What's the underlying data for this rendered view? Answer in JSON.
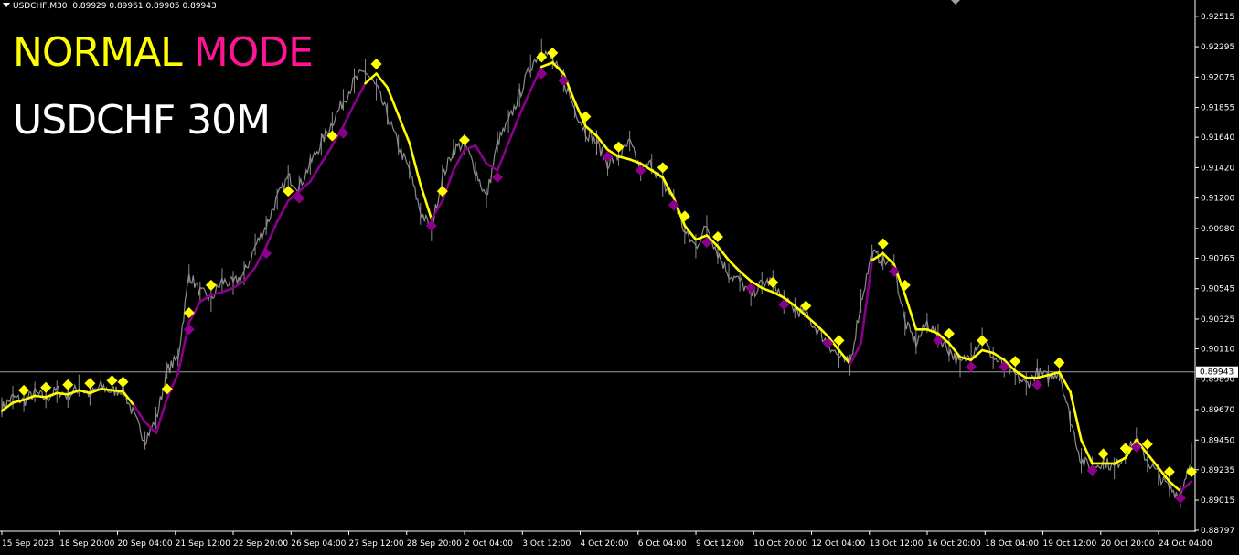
{
  "header": {
    "symbol": "USDCHF,M30",
    "ohlc": "0.89929 0.89961 0.89905 0.89943"
  },
  "overlay": {
    "mode_word1": "NORMAL",
    "mode_word2": "MODE",
    "pair_timeframe": "USDCHF 30M"
  },
  "colors": {
    "background": "#000000",
    "price": "#8c8c8c",
    "trend_up_line": "#ffff00",
    "trend_down_line": "#8b008b",
    "signal_up": "#ffff00",
    "signal_down": "#8b008b",
    "axis": "#ffffff",
    "current_price_line": "#a0a0a0"
  },
  "chart_data": {
    "type": "line",
    "title": "",
    "current_price": "0.89943",
    "ylim": [
      0.88797,
      0.9258
    ],
    "y_ticks": [
      "0.92515",
      "0.92295",
      "0.92075",
      "0.91855",
      "0.91640",
      "0.91420",
      "0.91200",
      "0.90980",
      "0.90765",
      "0.90545",
      "0.90325",
      "0.90110",
      "0.89890",
      "0.89670",
      "0.89450",
      "0.89235",
      "0.89015",
      "0.88797"
    ],
    "x_ticks": [
      "15 Sep 2023",
      "18 Sep 20:00",
      "20 Sep 04:00",
      "21 Sep 12:00",
      "22 Sep 20:00",
      "26 Sep 04:00",
      "27 Sep 12:00",
      "28 Sep 20:00",
      "2 Oct 04:00",
      "3 Oct 12:00",
      "4 Oct 20:00",
      "6 Oct 04:00",
      "9 Oct 12:00",
      "10 Oct 20:00",
      "12 Oct 04:00",
      "13 Oct 12:00",
      "16 Oct 20:00",
      "18 Oct 04:00",
      "19 Oct 12:00",
      "20 Oct 20:00",
      "24 Oct 04:00"
    ],
    "series": [
      {
        "role": "price",
        "values": [
          0.8968,
          0.8976,
          0.8973,
          0.8979,
          0.8975,
          0.8981,
          0.8977,
          0.8983,
          0.8978,
          0.8984,
          0.898,
          0.8982,
          0.8962,
          0.8945,
          0.896,
          0.8995,
          0.9005,
          0.9065,
          0.9052,
          0.9047,
          0.906,
          0.9058,
          0.9065,
          0.9085,
          0.91,
          0.912,
          0.9135,
          0.9128,
          0.9145,
          0.916,
          0.9175,
          0.919,
          0.9205,
          0.9212,
          0.92,
          0.918,
          0.9158,
          0.914,
          0.911,
          0.9098,
          0.9135,
          0.9155,
          0.916,
          0.914,
          0.912,
          0.916,
          0.9175,
          0.9195,
          0.9215,
          0.9228,
          0.922,
          0.9205,
          0.9185,
          0.9168,
          0.916,
          0.9145,
          0.915,
          0.916,
          0.914,
          0.9145,
          0.913,
          0.912,
          0.9095,
          0.9085,
          0.91,
          0.908,
          0.9065,
          0.906,
          0.905,
          0.9058,
          0.906,
          0.9045,
          0.904,
          0.9035,
          0.9025,
          0.9015,
          0.9005,
          0.9,
          0.9045,
          0.908,
          0.9075,
          0.907,
          0.903,
          0.9015,
          0.903,
          0.902,
          0.901,
          0.9,
          0.9008,
          0.9018,
          0.9005,
          0.8998,
          0.8992,
          0.8985,
          0.8994,
          0.899,
          0.8995,
          0.896,
          0.893,
          0.8925,
          0.893,
          0.8925,
          0.8935,
          0.8945,
          0.893,
          0.892,
          0.891,
          0.8905,
          0.8935
        ]
      },
      {
        "role": "trend",
        "values": [
          0.8966,
          0.8972,
          0.8974,
          0.8977,
          0.8976,
          0.8979,
          0.8978,
          0.8981,
          0.8979,
          0.8982,
          0.8981,
          0.898,
          0.897,
          0.8958,
          0.895,
          0.8975,
          0.8993,
          0.903,
          0.9045,
          0.905,
          0.9052,
          0.9055,
          0.906,
          0.907,
          0.9085,
          0.9103,
          0.9118,
          0.9125,
          0.9132,
          0.9145,
          0.9158,
          0.9172,
          0.9188,
          0.9203,
          0.921,
          0.92,
          0.918,
          0.916,
          0.913,
          0.9105,
          0.9118,
          0.914,
          0.9155,
          0.9158,
          0.9145,
          0.914,
          0.916,
          0.918,
          0.9198,
          0.9215,
          0.9218,
          0.921,
          0.919,
          0.9172,
          0.9165,
          0.9155,
          0.915,
          0.9148,
          0.9145,
          0.914,
          0.9135,
          0.912,
          0.91,
          0.909,
          0.9093,
          0.9085,
          0.9075,
          0.9067,
          0.906,
          0.9055,
          0.9052,
          0.9048,
          0.9042,
          0.9035,
          0.9028,
          0.902,
          0.901,
          0.9,
          0.9015,
          0.9075,
          0.908,
          0.9072,
          0.905,
          0.9025,
          0.9025,
          0.9022,
          0.9015,
          0.9005,
          0.9003,
          0.901,
          0.9008,
          0.9003,
          0.8995,
          0.899,
          0.899,
          0.8992,
          0.8994,
          0.898,
          0.8945,
          0.8928,
          0.8928,
          0.8928,
          0.8932,
          0.8945,
          0.8935,
          0.8925,
          0.8915,
          0.8908,
          0.8915
        ],
        "direction": [
          "u",
          "u",
          "u",
          "u",
          "u",
          "u",
          "u",
          "u",
          "u",
          "u",
          "u",
          "u",
          "d",
          "d",
          "d",
          "d",
          "d",
          "d",
          "d",
          "d",
          "d",
          "d",
          "d",
          "d",
          "d",
          "d",
          "d",
          "d",
          "d",
          "d",
          "d",
          "d",
          "d",
          "u",
          "u",
          "u",
          "u",
          "u",
          "u",
          "d",
          "d",
          "d",
          "d",
          "d",
          "d",
          "d",
          "d",
          "d",
          "d",
          "u",
          "u",
          "u",
          "u",
          "u",
          "u",
          "u",
          "u",
          "u",
          "u",
          "u",
          "u",
          "u",
          "u",
          "u",
          "u",
          "u",
          "u",
          "u",
          "u",
          "u",
          "u",
          "u",
          "u",
          "u",
          "u",
          "u",
          "u",
          "d",
          "d",
          "u",
          "u",
          "u",
          "u",
          "u",
          "u",
          "u",
          "u",
          "u",
          "u",
          "u",
          "u",
          "u",
          "u",
          "u",
          "u",
          "u",
          "u",
          "u",
          "u",
          "u",
          "u",
          "u",
          "u",
          "u",
          "u",
          "u",
          "u",
          "d",
          "d"
        ]
      }
    ],
    "signals_up_at": [
      2,
      4,
      6,
      8,
      10,
      11,
      15,
      17,
      19,
      26,
      30,
      34,
      40,
      42,
      49,
      50,
      53,
      56,
      60,
      62,
      65,
      70,
      73,
      76,
      80,
      82,
      86,
      89,
      92,
      96,
      100,
      102,
      104,
      106,
      108
    ],
    "signals_down_at": [
      17,
      24,
      27,
      31,
      39,
      45,
      49,
      51,
      55,
      58,
      61,
      64,
      68,
      71,
      75,
      81,
      85,
      88,
      91,
      94,
      99,
      103,
      107
    ]
  }
}
